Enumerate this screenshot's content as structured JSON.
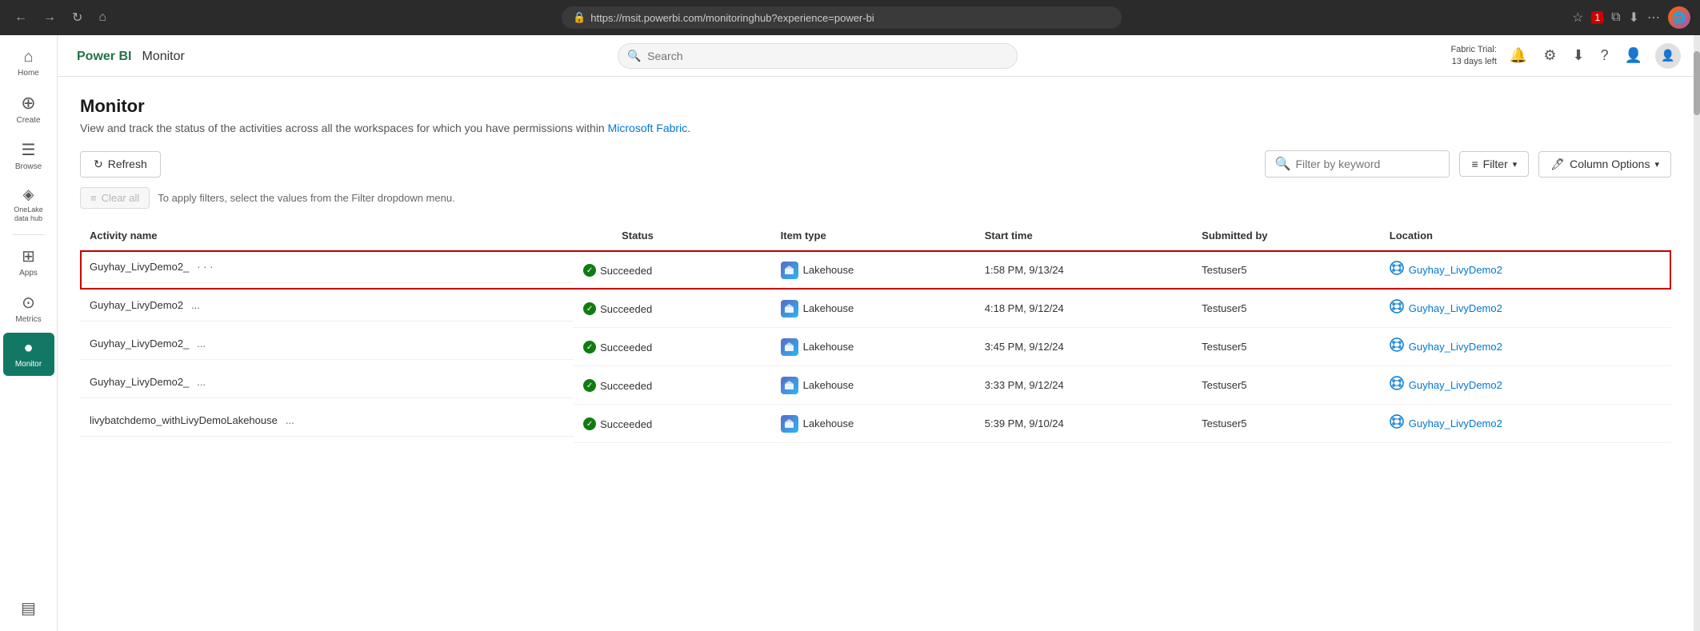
{
  "browser": {
    "url": "https://msit.powerbi.com/monitoringhub?experience=power-bi",
    "nav_back": "←",
    "nav_forward": "→",
    "nav_refresh": "↻",
    "nav_home": "⌂"
  },
  "topbar": {
    "app_name": "Power BI",
    "section_name": "Monitor",
    "search_placeholder": "Search",
    "fabric_trial_line1": "Fabric Trial:",
    "fabric_trial_line2": "13 days left"
  },
  "sidebar": {
    "items": [
      {
        "id": "home",
        "label": "Home",
        "icon": "⌂"
      },
      {
        "id": "create",
        "label": "Create",
        "icon": "+"
      },
      {
        "id": "browse",
        "label": "Browse",
        "icon": "☰"
      },
      {
        "id": "onelake",
        "label": "OneLake data hub",
        "icon": "◈"
      },
      {
        "id": "apps",
        "label": "Apps",
        "icon": "⊞"
      },
      {
        "id": "metrics",
        "label": "Metrics",
        "icon": "⊙"
      },
      {
        "id": "monitor",
        "label": "Monitor",
        "icon": "●",
        "active": true
      },
      {
        "id": "workspaces",
        "label": "",
        "icon": "▤"
      }
    ]
  },
  "page": {
    "title": "Monitor",
    "subtitle": "View and track the status of the activities across all the workspaces for which you have permissions within Microsoft Fabric.",
    "subtitle_link": "Microsoft Fabric"
  },
  "toolbar": {
    "refresh_label": "Refresh",
    "filter_placeholder": "Filter by keyword",
    "filter_label": "Filter",
    "column_options_label": "Column Options"
  },
  "filter_bar": {
    "clear_all_label": "Clear all",
    "hint_text": "To apply filters, select the values from the Filter dropdown menu."
  },
  "table": {
    "columns": [
      {
        "id": "activity_name",
        "label": "Activity name"
      },
      {
        "id": "status",
        "label": "Status"
      },
      {
        "id": "item_type",
        "label": "Item type"
      },
      {
        "id": "start_time",
        "label": "Start time"
      },
      {
        "id": "submitted_by",
        "label": "Submitted by"
      },
      {
        "id": "location",
        "label": "Location"
      }
    ],
    "rows": [
      {
        "activity_name": "Guyhay_LivyDemo2_",
        "status": "Succeeded",
        "item_type": "Lakehouse",
        "start_time": "1:58 PM, 9/13/24",
        "submitted_by": "Testuser5",
        "location": "Guyhay_LivyDemo2",
        "selected": true
      },
      {
        "activity_name": "Guyhay_LivyDemo2",
        "status": "Succeeded",
        "item_type": "Lakehouse",
        "start_time": "4:18 PM, 9/12/24",
        "submitted_by": "Testuser5",
        "location": "Guyhay_LivyDemo2",
        "selected": false
      },
      {
        "activity_name": "Guyhay_LivyDemo2_",
        "status": "Succeeded",
        "item_type": "Lakehouse",
        "start_time": "3:45 PM, 9/12/24",
        "submitted_by": "Testuser5",
        "location": "Guyhay_LivyDemo2",
        "selected": false
      },
      {
        "activity_name": "Guyhay_LivyDemo2_",
        "status": "Succeeded",
        "item_type": "Lakehouse",
        "start_time": "3:33 PM, 9/12/24",
        "submitted_by": "Testuser5",
        "location": "Guyhay_LivyDemo2",
        "selected": false
      },
      {
        "activity_name": "livybatchdemo_withLivyDemoLakehouse",
        "status": "Succeeded",
        "item_type": "Lakehouse",
        "start_time": "5:39 PM, 9/10/24",
        "submitted_by": "Testuser5",
        "location": "Guyhay_LivyDemo2",
        "selected": false
      }
    ]
  },
  "colors": {
    "accent_green": "#117865",
    "success_green": "#107c10",
    "link_blue": "#0078d4",
    "brand_green": "#217346",
    "selected_red": "#cc0000"
  }
}
